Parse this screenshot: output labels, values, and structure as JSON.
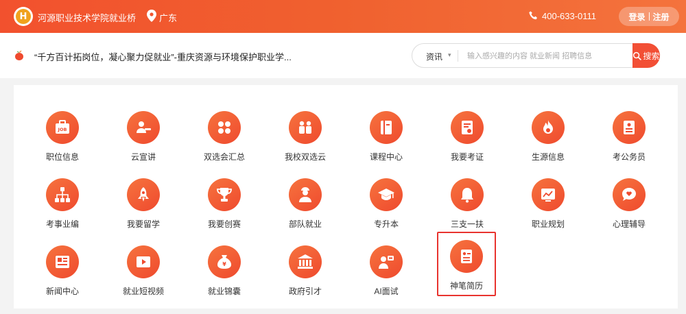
{
  "header": {
    "logo_letter": "H",
    "site_title": "河源职业技术学院就业桥",
    "location": "广东",
    "phone": "400-633-0111",
    "login": "登录",
    "register": "注册"
  },
  "news": {
    "headline": "“千方百计拓岗位，凝心聚力促就业”-重庆资源与环境保护职业学..."
  },
  "search": {
    "category": "资讯",
    "placeholder": "输入感兴趣的内容 就业新闻 招聘信息",
    "button_label": "搜索"
  },
  "services": [
    {
      "label": "职位信息",
      "icon": "job-icon"
    },
    {
      "label": "云宣讲",
      "icon": "presenter-icon"
    },
    {
      "label": "双选会汇总",
      "icon": "grid-icon"
    },
    {
      "label": "我校双选云",
      "icon": "people-icon"
    },
    {
      "label": "课程中心",
      "icon": "book-icon"
    },
    {
      "label": "我要考证",
      "icon": "certificate-icon"
    },
    {
      "label": "生源信息",
      "icon": "flame-icon"
    },
    {
      "label": "考公务员",
      "icon": "document-icon"
    },
    {
      "label": "考事业编",
      "icon": "org-chart-icon"
    },
    {
      "label": "我要留学",
      "icon": "rocket-icon"
    },
    {
      "label": "我要创赛",
      "icon": "trophy-icon"
    },
    {
      "label": "部队就业",
      "icon": "soldier-icon"
    },
    {
      "label": "专升本",
      "icon": "graduation-cap-icon"
    },
    {
      "label": "三支一扶",
      "icon": "bell-icon"
    },
    {
      "label": "职业规划",
      "icon": "chart-board-icon"
    },
    {
      "label": "心理辅导",
      "icon": "chat-bubble-icon"
    },
    {
      "label": "新闻中心",
      "icon": "newspaper-icon"
    },
    {
      "label": "就业短视频",
      "icon": "video-icon"
    },
    {
      "label": "就业锦囊",
      "icon": "money-bag-icon"
    },
    {
      "label": "政府引才",
      "icon": "government-icon"
    },
    {
      "label": "AI面试",
      "icon": "ai-interview-icon"
    },
    {
      "label": "神笔简历",
      "icon": "resume-icon"
    }
  ],
  "selected_service": "神笔简历",
  "colors": {
    "brand": "#f2512e",
    "icon_gradient_start": "#f6733e",
    "icon_gradient_end": "#ef4a2e",
    "selection_border": "#e8332e"
  }
}
